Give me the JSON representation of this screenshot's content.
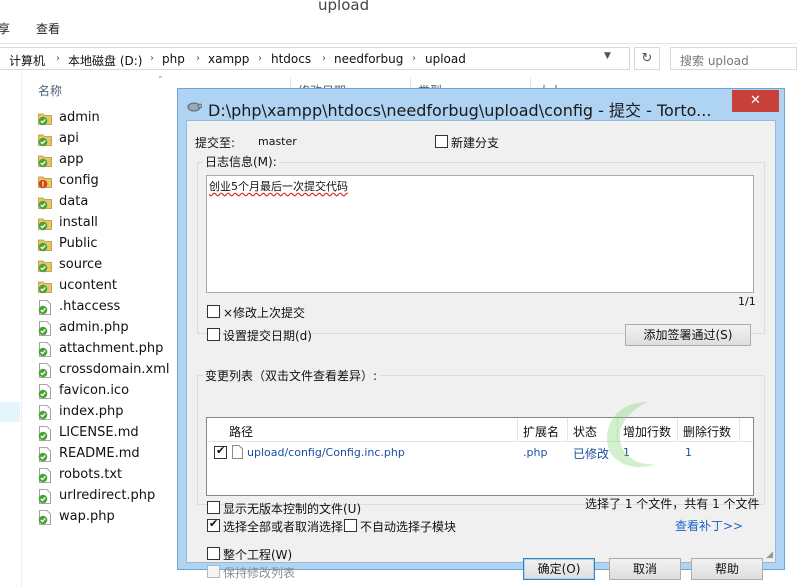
{
  "window": {
    "title": "upload"
  },
  "ribbon": {
    "tabs": [
      "享",
      "查看"
    ]
  },
  "address": {
    "crumbs": [
      "计算机",
      "本地磁盘 (D:)",
      "php",
      "xampp",
      "htdocs",
      "needforbug",
      "upload"
    ]
  },
  "search": {
    "placeholder": "搜索 upload"
  },
  "columns": {
    "name": "名称",
    "date": "修改日期",
    "type": "类型",
    "size": "大小"
  },
  "files": [
    {
      "name": "admin",
      "icon": "folder-git-ok-icon"
    },
    {
      "name": "api",
      "icon": "folder-git-ok-icon"
    },
    {
      "name": "app",
      "icon": "folder-git-ok-icon"
    },
    {
      "name": "config",
      "icon": "folder-git-modified-icon"
    },
    {
      "name": "data",
      "icon": "folder-git-ok-icon"
    },
    {
      "name": "install",
      "icon": "folder-git-ok-icon"
    },
    {
      "name": "Public",
      "icon": "folder-git-ok-icon"
    },
    {
      "name": "source",
      "icon": "folder-git-ok-icon"
    },
    {
      "name": "ucontent",
      "icon": "folder-git-ok-icon"
    },
    {
      "name": ".htaccess",
      "icon": "file-git-ok-icon"
    },
    {
      "name": "admin.php",
      "icon": "file-git-ok-icon"
    },
    {
      "name": "attachment.php",
      "icon": "file-git-ok-icon"
    },
    {
      "name": "crossdomain.xml",
      "icon": "file-git-ok-icon"
    },
    {
      "name": "favicon.ico",
      "icon": "image-git-ok-icon"
    },
    {
      "name": "index.php",
      "icon": "file-git-ok-icon"
    },
    {
      "name": "LICENSE.md",
      "icon": "file-git-ok-icon"
    },
    {
      "name": "README.md",
      "icon": "file-git-ok-icon"
    },
    {
      "name": "robots.txt",
      "icon": "file-git-ok-icon"
    },
    {
      "name": "urlredirect.php",
      "icon": "file-git-ok-icon"
    },
    {
      "name": "wap.php",
      "icon": "file-git-ok-icon"
    }
  ],
  "dialog": {
    "title": "D:\\php\\xampp\\htdocs\\needforbug\\upload\\config - 提交 - Torto...",
    "close_label": "✕",
    "commit_to_label": "提交至:",
    "branch": "master",
    "new_branch_label": "新建分支",
    "log_group_label": "日志信息(M):",
    "message": "创业5个月最后一次提交代码",
    "page_counter": "1/1",
    "amend_label": "×修改上次提交",
    "set_date_label": "设置提交日期(d)",
    "signoff_button": "添加签署通过(S)",
    "changes_label": "变更列表（双击文件查看差异）:",
    "table_headers": [
      "路径",
      "扩展名",
      "状态",
      "增加行数",
      "删除行数"
    ],
    "row": {
      "checked": true,
      "path": "upload/config/Config.inc.php",
      "ext": ".php",
      "status": "已修改",
      "added": "1",
      "deleted": "1"
    },
    "show_unversioned_label": "显示无版本控制的文件(U)",
    "select_all_label": "选择全部或者取消选择",
    "no_auto_submodule_label": "不自动选择子模块",
    "selection_summary": "选择了 1 个文件，共有 1 个文件",
    "view_patch_link": "查看补丁>>",
    "whole_project_label": "整个工程(W)",
    "keep_list_label": "保持修改列表",
    "ok_button": "确定(O)",
    "cancel_button": "取消",
    "help_button": "帮助"
  },
  "colors": {
    "dialog_frame": "#afd3f2",
    "close_red": "#c7403a",
    "git_ok_green": "#4aa338",
    "git_modified_red": "#d5421d",
    "link_blue": "#1b63c6"
  }
}
